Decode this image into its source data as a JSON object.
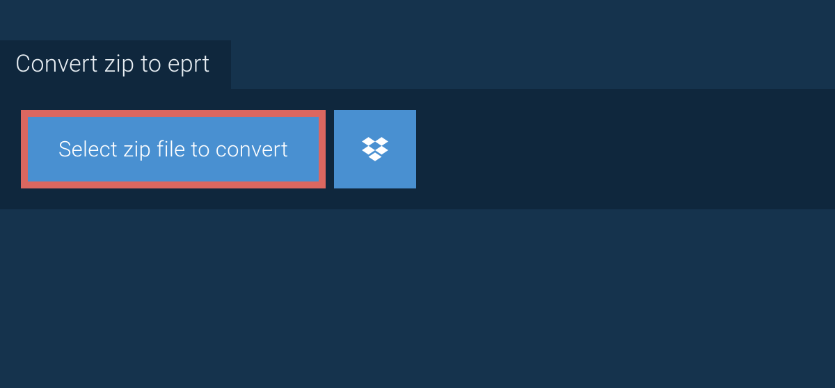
{
  "tab": {
    "title": "Convert zip to eprt"
  },
  "actions": {
    "select_label": "Select zip file to convert"
  },
  "colors": {
    "page_bg": "#15334d",
    "panel_bg": "#0f273d",
    "button_bg": "#4990d1",
    "highlight_border": "#db6760",
    "text_light": "#ffffff"
  }
}
